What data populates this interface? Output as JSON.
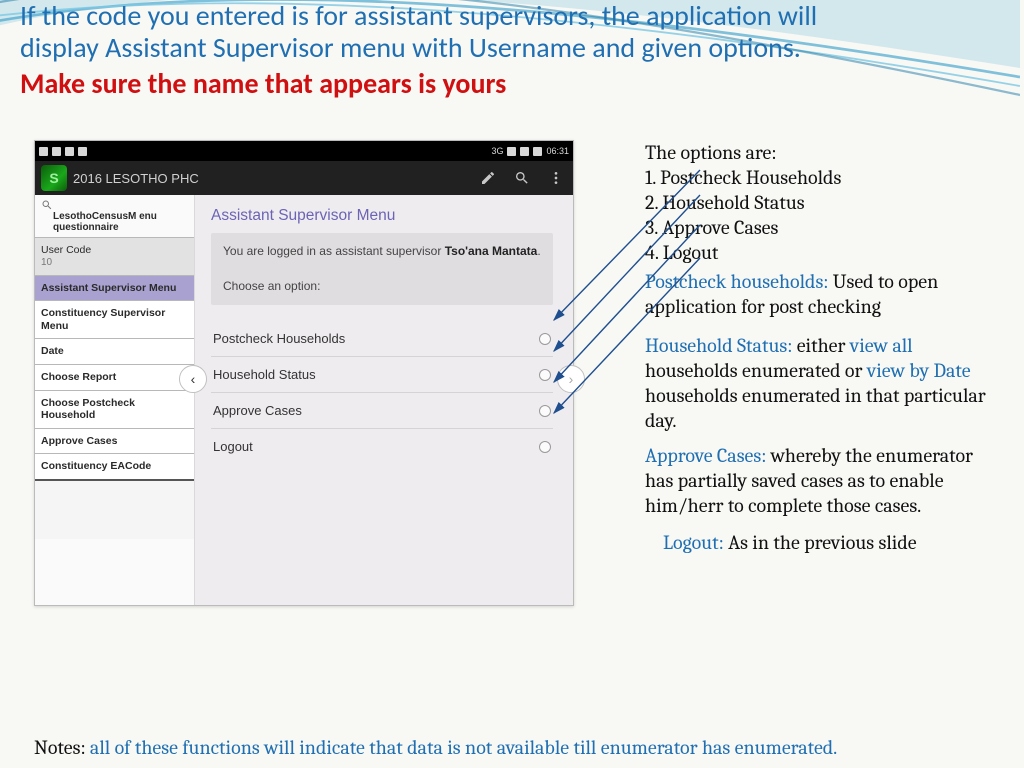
{
  "heading": {
    "line1": "If the code you entered is for assistant supervisors, the application will",
    "line2": "display Assistant Supervisor menu with Username and given options.",
    "warn": "Make sure the name that appears is yours"
  },
  "statusbar": {
    "time": "06:31",
    "net": "3G"
  },
  "appbar": {
    "title": "2016 LESOTHO PHC"
  },
  "side_tree": {
    "search_hint": "",
    "questionnaire": "LesothoCensusM\nenu questionnaire",
    "items": [
      {
        "label": "User Code",
        "sub": "10",
        "cls": "muted"
      },
      {
        "label": "Assistant Supervisor Menu",
        "cls": "sel"
      },
      {
        "label": "Constituency Supervisor Menu"
      },
      {
        "label": "Date"
      },
      {
        "label": "Choose Report"
      },
      {
        "label": "Choose Postcheck Household"
      },
      {
        "label": "Approve Cases"
      },
      {
        "label": "Constituency EACode"
      }
    ]
  },
  "main_pane": {
    "title": "Assistant Supervisor Menu",
    "info_prefix": "You are logged in as assistant supervisor ",
    "info_name": "Tso'ana Mantata",
    "info_suffix": ".",
    "choose": "Choose an option:",
    "options": [
      "Postcheck Households",
      "Household Status",
      "Approve Cases",
      "Logout"
    ]
  },
  "right": {
    "options_intro": "The options are:",
    "opt1": "1. Postcheck Households",
    "opt2": "2. Household Status",
    "opt3": "3. Approve Cases",
    "opt4": "4. Logout",
    "postcheck_label": "Postcheck households:",
    "postcheck_text": " Used to open application for post checking",
    "hh_label": "Household Status:",
    "hh_text_a": "  either ",
    "hh_view_all": "view all",
    "hh_text_b": " households enumerated or ",
    "hh_view_date": "view by Date",
    "hh_text_c": " households enumerated in that particular day.",
    "approve_label": "Approve Cases:",
    "approve_text": " whereby the enumerator has partially saved cases as to enable him/herr to complete those cases.",
    "logout_label": "Logout:",
    "logout_text": " As in the previous slide"
  },
  "notes": {
    "label": "Notes:",
    "text": " all of these functions will indicate that data is not available till enumerator has enumerated."
  }
}
